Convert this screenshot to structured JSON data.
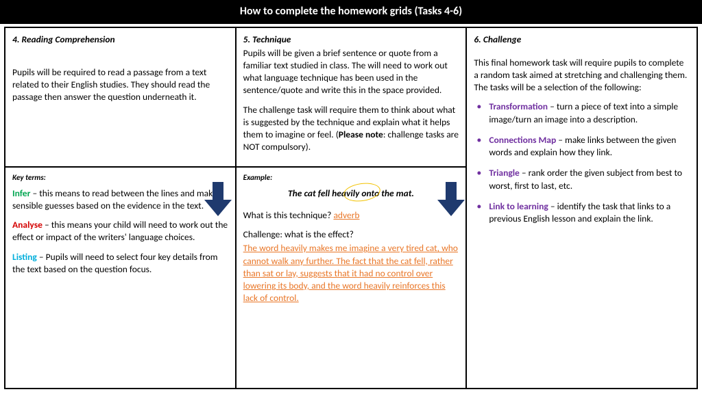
{
  "title": "How to complete the homework grids (Tasks 4-6)",
  "task4": {
    "heading": "4. Reading Comprehension",
    "body": "Pupils will be required to read a passage from a text related to their English studies. They should read the passage then answer the question underneath it."
  },
  "task5": {
    "heading": "5. Technique",
    "p1": "Pupils will be given a brief sentence or quote from a familiar text studied in class. The will need to work out what language technique has been used in the sentence/quote and write this in the space provided.",
    "p2a": "The challenge task will require them to think about what is suggested by the technique and explain what it helps them to imagine or feel. (",
    "p2b": "Please note",
    "p2c": ": challenge tasks are NOT compulsory)."
  },
  "task6": {
    "heading": "6. Challenge",
    "intro": "This final homework task will require pupils to complete a random task aimed at stretching and challenging them. The tasks will be a selection of the following:",
    "items": [
      {
        "term": "Transformation",
        "desc": " – turn a piece of text into a simple image/turn an image into a description."
      },
      {
        "term": "Connections Map",
        "desc": " – make links between the given words and explain how they link."
      },
      {
        "term": "Triangle",
        "desc": " – rank order the given subject from best to worst, first to last, etc."
      },
      {
        "term": "Link to learning",
        "desc": " – identify the task that links to a previous English lesson and explain the link."
      }
    ]
  },
  "keyterms": {
    "heading": "Key terms:",
    "infer_term": "Infer",
    "infer_desc": " – this means to read between the lines and make sensible guesses based on the evidence in the text.",
    "analyse_term": "Analyse",
    "analyse_desc": " – this means your child will need to work out the effect or impact of the writers' language choices.",
    "listing_term": "Listing",
    "listing_desc": " – Pupils will need to select four key details from the text based on the question focus."
  },
  "example": {
    "heading": "Example:",
    "quote": "The cat fell heavily onto the mat.",
    "q1_label": "What is this technique? ",
    "q1_answer": "adverb",
    "q2_label": "Challenge: what is the effect?",
    "q2_answer": "The word heavily makes me imagine a very tired cat, who cannot walk any further. The fact that the cat fell, rather than sat or lay, suggests that it had no control over lowering its body, and the word heavily reinforces this lack of control."
  }
}
